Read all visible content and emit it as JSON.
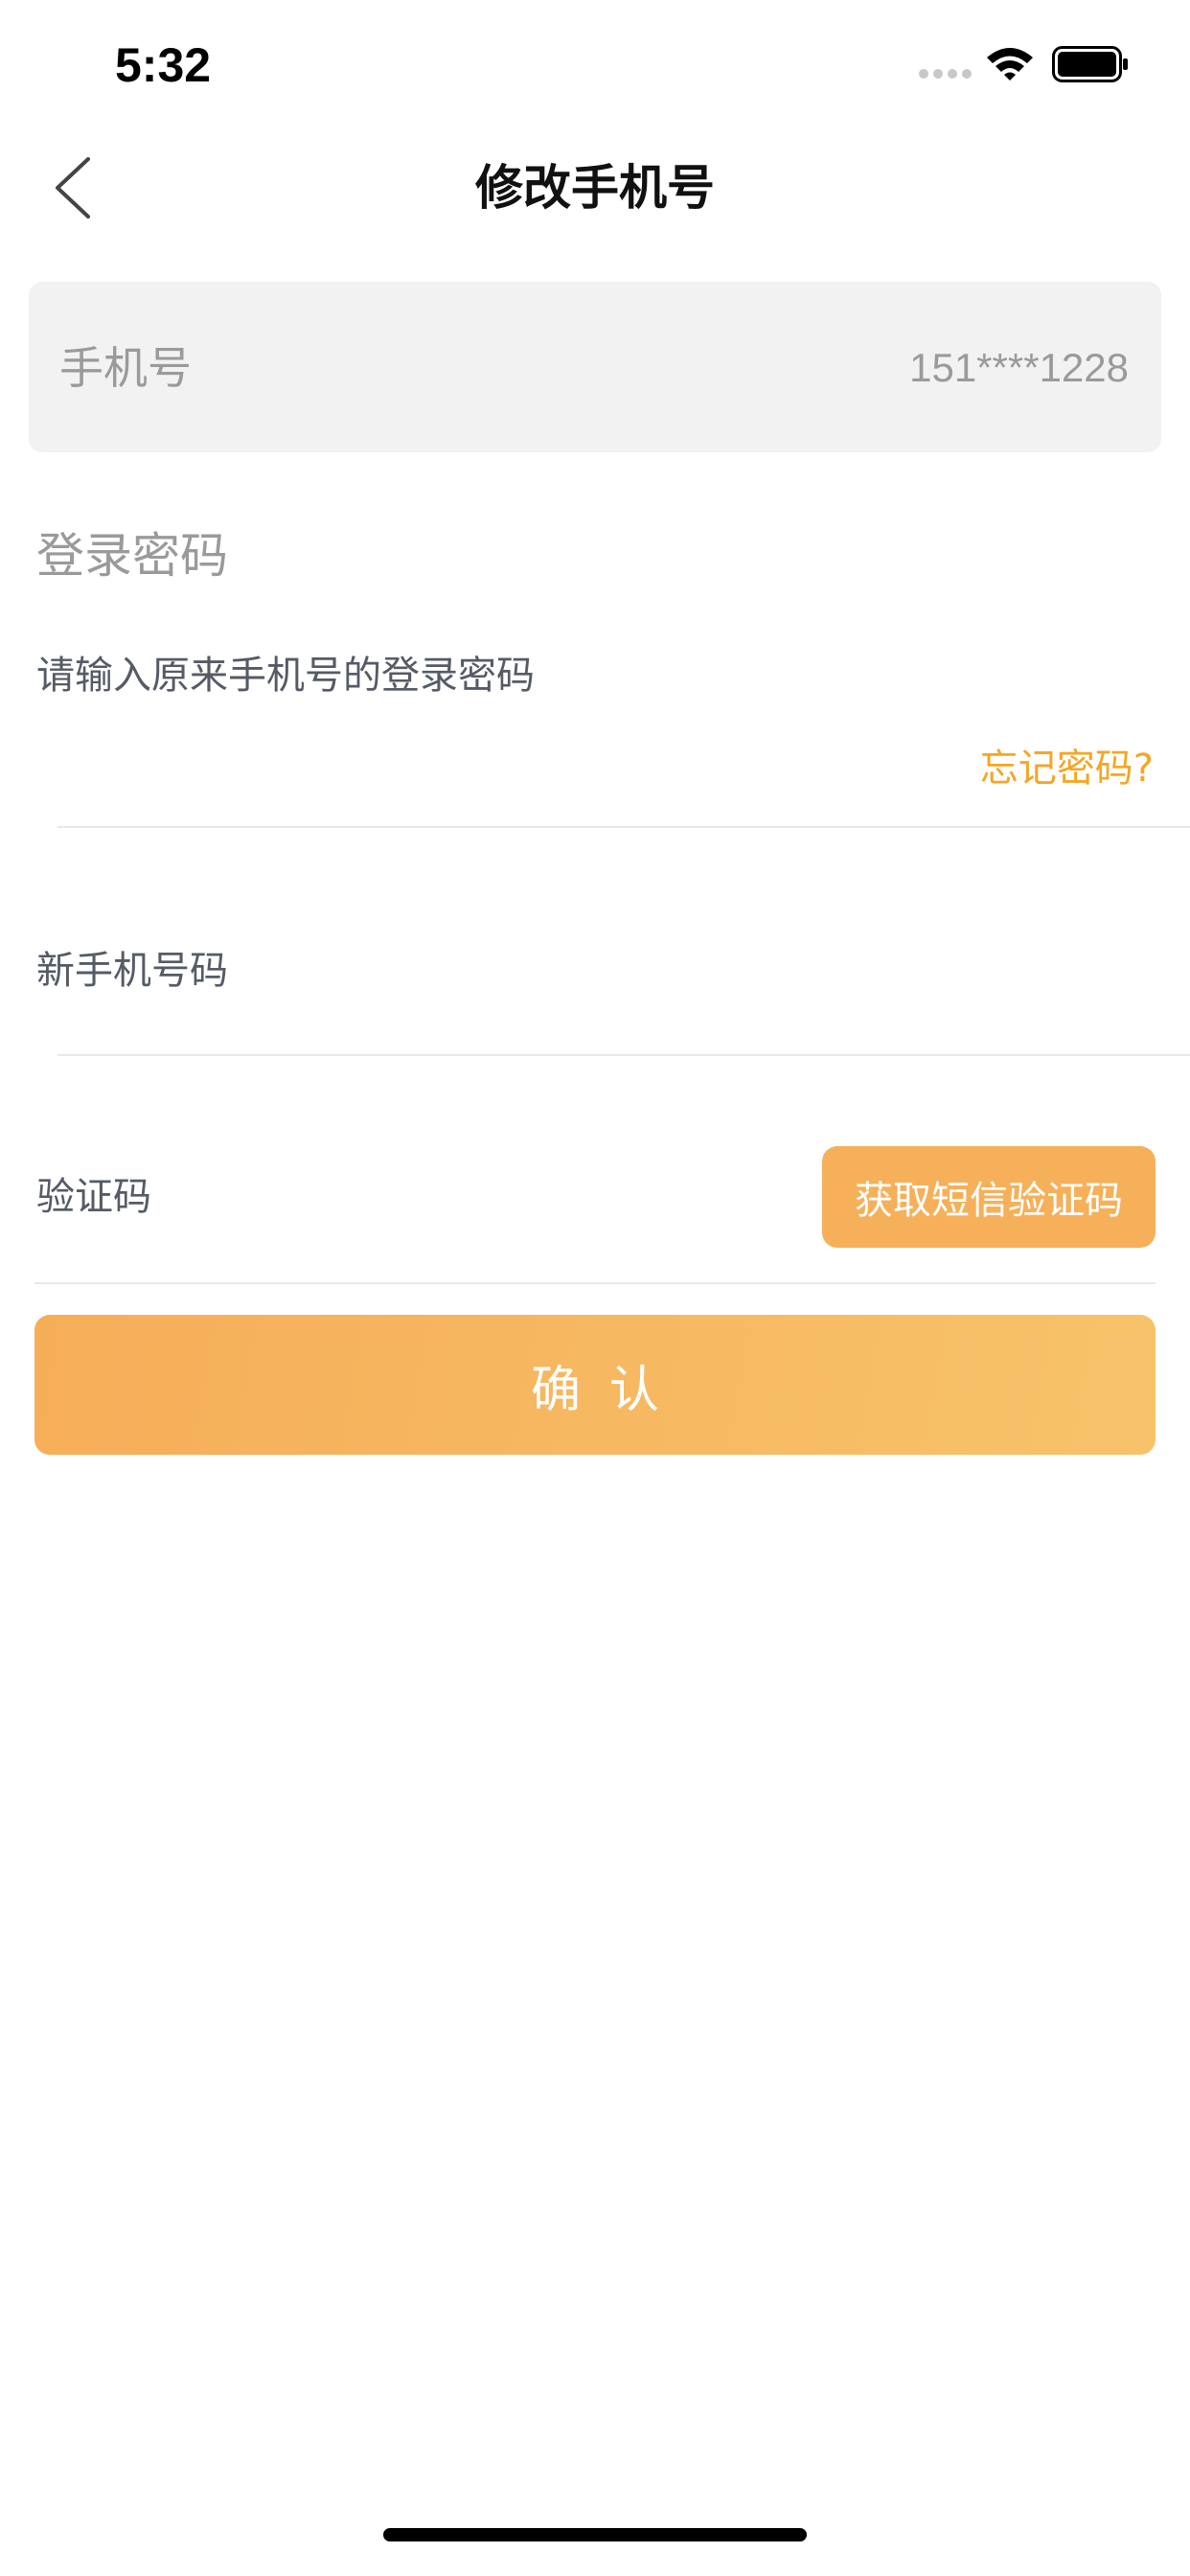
{
  "status_bar": {
    "time": "5:32"
  },
  "header": {
    "title": "修改手机号",
    "back_icon": "chevron-left-icon"
  },
  "phone_box": {
    "label": "手机号",
    "value": "151****1228"
  },
  "password_section": {
    "label": "登录密码",
    "placeholder": "请输入原来手机号的登录密码",
    "forgot_link": "忘记密码?"
  },
  "new_phone": {
    "placeholder": "新手机号码"
  },
  "verification": {
    "placeholder": "验证码",
    "sms_button": "获取短信验证码"
  },
  "confirm": {
    "label": "确认"
  },
  "colors": {
    "accent": "#f5a623",
    "button": "#f6b05a",
    "gradient_start": "#f6ad58",
    "gradient_end": "#f7c36a",
    "label_gray": "#9a9a9a"
  }
}
